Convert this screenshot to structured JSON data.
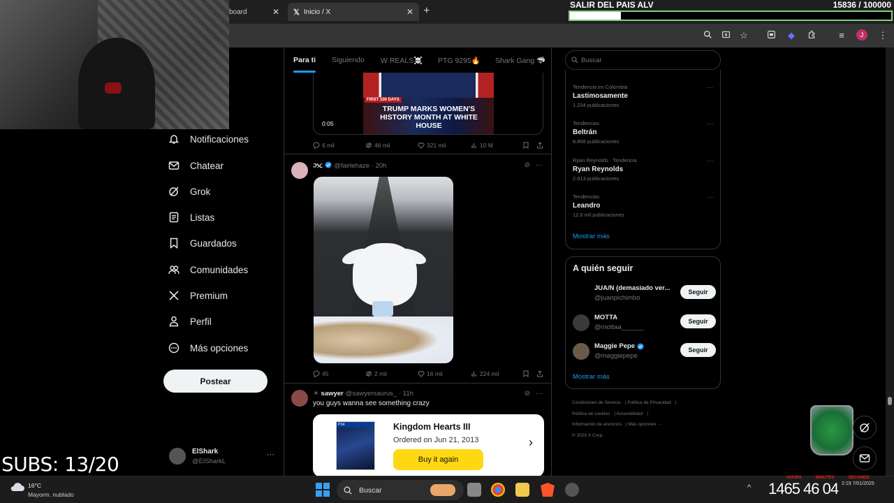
{
  "browser": {
    "tabs": [
      {
        "label": "board"
      },
      {
        "label": "Inicio / X"
      }
    ],
    "profile_initial": "J"
  },
  "goal_overlay": {
    "title": "SALIR DEL PAIS ALV",
    "count": "15836 / 100000",
    "progress": 0.158,
    "bar_color": "#7fd27f"
  },
  "subs_overlay": "SUBS: 13/20",
  "nav": {
    "items": [
      {
        "label": "Notificaciones",
        "icon": "bell-icon"
      },
      {
        "label": "Chatear",
        "icon": "mail-icon"
      },
      {
        "label": "Grok",
        "icon": "grok-icon"
      },
      {
        "label": "Listas",
        "icon": "list-icon"
      },
      {
        "label": "Guardados",
        "icon": "bookmark-icon"
      },
      {
        "label": "Comunidades",
        "icon": "people-icon"
      },
      {
        "label": "Premium",
        "icon": "x-icon"
      },
      {
        "label": "Perfil",
        "icon": "person-icon"
      },
      {
        "label": "Más opciones",
        "icon": "more-circle-icon"
      }
    ],
    "post_label": "Postear",
    "account": {
      "name": "ElShark",
      "handle": "@ElSharkL"
    }
  },
  "timeline": {
    "tabs": [
      "Para ti",
      "Siguiendo",
      "W REALS☠️",
      "PTG 9295🔥",
      "Shark Gang 🦈"
    ],
    "active_tab": "Para ti",
    "post1": {
      "media_badge": "FIRST 100 DAYS",
      "media_headline": "TRUMP MARKS WOMEN'S HISTORY MONTH AT WHITE HOUSE",
      "duration": "0:05",
      "replies": "6 mil",
      "reposts": "46 mil",
      "likes": "321 mil",
      "views": "10 M"
    },
    "post2": {
      "name": "ઝ૮",
      "handle": "@fairlehaze",
      "time": "20h",
      "replies": "45",
      "reposts": "2 mil",
      "likes": "16 mil",
      "views": "224 mil"
    },
    "post3": {
      "name": "sawyer",
      "handle": "@sawyersaurus_",
      "time": "11h",
      "text": "you guys wanna see something crazy",
      "card_title": "Kingdom Hearts III",
      "card_date": "Ordered on Jun 21, 2013",
      "card_button": "Buy it again",
      "cover_label": "PS4"
    }
  },
  "sidebar": {
    "search_placeholder": "Buscar",
    "trends": [
      {
        "context": "Tendencia en Colombia",
        "name": "Lastimosamente",
        "count": "1.234 publicaciones"
      },
      {
        "context": "Tendencias",
        "name": "Beltrán",
        "count": "8.868 publicaciones"
      },
      {
        "context": "Ryan Reynolds · Tendencia",
        "name": "Ryan Reynolds",
        "count": "2.613 publicaciones"
      },
      {
        "context": "Tendencias",
        "name": "Leandro",
        "count": "12,6 mil publicaciones"
      }
    ],
    "show_more": "Mostrar más",
    "who_to_follow_title": "A quién seguir",
    "who_to_follow": [
      {
        "name": "JUA/N (demasiado ver...",
        "handle": "@juanpichimbo",
        "button": "Seguir"
      },
      {
        "name": "MOTTA",
        "handle": "@mottaa______",
        "button": "Seguir"
      },
      {
        "name": "Maggie Pepe",
        "handle": "@maggiepepe",
        "button": "Seguir"
      }
    ],
    "footer": [
      "Condiciones de Servicio",
      "Política de Privacidad",
      "Política de cookies",
      "Accesibilidad",
      "Información de anuncios",
      "Más opciones ···",
      "© 2025 X Corp."
    ]
  },
  "taskbar": {
    "temperature": "16°C",
    "weather": "Mayorm. nublado",
    "search_label": "Buscar",
    "clock_big": "1465   46   04",
    "clock_small": "2:19\n7/01/2025",
    "timer_labels": [
      "HOURS",
      "MINUTES",
      "SECONDS"
    ]
  }
}
